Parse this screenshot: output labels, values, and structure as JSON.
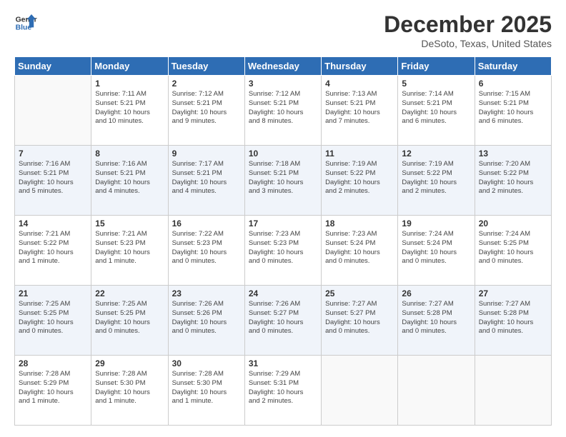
{
  "logo": {
    "name": "GeneralBlue",
    "line1": "General",
    "line2": "Blue"
  },
  "title": "December 2025",
  "location": "DeSoto, Texas, United States",
  "weekdays": [
    "Sunday",
    "Monday",
    "Tuesday",
    "Wednesday",
    "Thursday",
    "Friday",
    "Saturday"
  ],
  "weeks": [
    [
      {
        "day": "",
        "info": ""
      },
      {
        "day": "1",
        "info": "Sunrise: 7:11 AM\nSunset: 5:21 PM\nDaylight: 10 hours\nand 10 minutes."
      },
      {
        "day": "2",
        "info": "Sunrise: 7:12 AM\nSunset: 5:21 PM\nDaylight: 10 hours\nand 9 minutes."
      },
      {
        "day": "3",
        "info": "Sunrise: 7:12 AM\nSunset: 5:21 PM\nDaylight: 10 hours\nand 8 minutes."
      },
      {
        "day": "4",
        "info": "Sunrise: 7:13 AM\nSunset: 5:21 PM\nDaylight: 10 hours\nand 7 minutes."
      },
      {
        "day": "5",
        "info": "Sunrise: 7:14 AM\nSunset: 5:21 PM\nDaylight: 10 hours\nand 6 minutes."
      },
      {
        "day": "6",
        "info": "Sunrise: 7:15 AM\nSunset: 5:21 PM\nDaylight: 10 hours\nand 6 minutes."
      }
    ],
    [
      {
        "day": "7",
        "info": "Sunrise: 7:16 AM\nSunset: 5:21 PM\nDaylight: 10 hours\nand 5 minutes."
      },
      {
        "day": "8",
        "info": "Sunrise: 7:16 AM\nSunset: 5:21 PM\nDaylight: 10 hours\nand 4 minutes."
      },
      {
        "day": "9",
        "info": "Sunrise: 7:17 AM\nSunset: 5:21 PM\nDaylight: 10 hours\nand 4 minutes."
      },
      {
        "day": "10",
        "info": "Sunrise: 7:18 AM\nSunset: 5:21 PM\nDaylight: 10 hours\nand 3 minutes."
      },
      {
        "day": "11",
        "info": "Sunrise: 7:19 AM\nSunset: 5:22 PM\nDaylight: 10 hours\nand 2 minutes."
      },
      {
        "day": "12",
        "info": "Sunrise: 7:19 AM\nSunset: 5:22 PM\nDaylight: 10 hours\nand 2 minutes."
      },
      {
        "day": "13",
        "info": "Sunrise: 7:20 AM\nSunset: 5:22 PM\nDaylight: 10 hours\nand 2 minutes."
      }
    ],
    [
      {
        "day": "14",
        "info": "Sunrise: 7:21 AM\nSunset: 5:22 PM\nDaylight: 10 hours\nand 1 minute."
      },
      {
        "day": "15",
        "info": "Sunrise: 7:21 AM\nSunset: 5:23 PM\nDaylight: 10 hours\nand 1 minute."
      },
      {
        "day": "16",
        "info": "Sunrise: 7:22 AM\nSunset: 5:23 PM\nDaylight: 10 hours\nand 0 minutes."
      },
      {
        "day": "17",
        "info": "Sunrise: 7:23 AM\nSunset: 5:23 PM\nDaylight: 10 hours\nand 0 minutes."
      },
      {
        "day": "18",
        "info": "Sunrise: 7:23 AM\nSunset: 5:24 PM\nDaylight: 10 hours\nand 0 minutes."
      },
      {
        "day": "19",
        "info": "Sunrise: 7:24 AM\nSunset: 5:24 PM\nDaylight: 10 hours\nand 0 minutes."
      },
      {
        "day": "20",
        "info": "Sunrise: 7:24 AM\nSunset: 5:25 PM\nDaylight: 10 hours\nand 0 minutes."
      }
    ],
    [
      {
        "day": "21",
        "info": "Sunrise: 7:25 AM\nSunset: 5:25 PM\nDaylight: 10 hours\nand 0 minutes."
      },
      {
        "day": "22",
        "info": "Sunrise: 7:25 AM\nSunset: 5:25 PM\nDaylight: 10 hours\nand 0 minutes."
      },
      {
        "day": "23",
        "info": "Sunrise: 7:26 AM\nSunset: 5:26 PM\nDaylight: 10 hours\nand 0 minutes."
      },
      {
        "day": "24",
        "info": "Sunrise: 7:26 AM\nSunset: 5:27 PM\nDaylight: 10 hours\nand 0 minutes."
      },
      {
        "day": "25",
        "info": "Sunrise: 7:27 AM\nSunset: 5:27 PM\nDaylight: 10 hours\nand 0 minutes."
      },
      {
        "day": "26",
        "info": "Sunrise: 7:27 AM\nSunset: 5:28 PM\nDaylight: 10 hours\nand 0 minutes."
      },
      {
        "day": "27",
        "info": "Sunrise: 7:27 AM\nSunset: 5:28 PM\nDaylight: 10 hours\nand 0 minutes."
      }
    ],
    [
      {
        "day": "28",
        "info": "Sunrise: 7:28 AM\nSunset: 5:29 PM\nDaylight: 10 hours\nand 1 minute."
      },
      {
        "day": "29",
        "info": "Sunrise: 7:28 AM\nSunset: 5:30 PM\nDaylight: 10 hours\nand 1 minute."
      },
      {
        "day": "30",
        "info": "Sunrise: 7:28 AM\nSunset: 5:30 PM\nDaylight: 10 hours\nand 1 minute."
      },
      {
        "day": "31",
        "info": "Sunrise: 7:29 AM\nSunset: 5:31 PM\nDaylight: 10 hours\nand 2 minutes."
      },
      {
        "day": "",
        "info": ""
      },
      {
        "day": "",
        "info": ""
      },
      {
        "day": "",
        "info": ""
      }
    ]
  ]
}
